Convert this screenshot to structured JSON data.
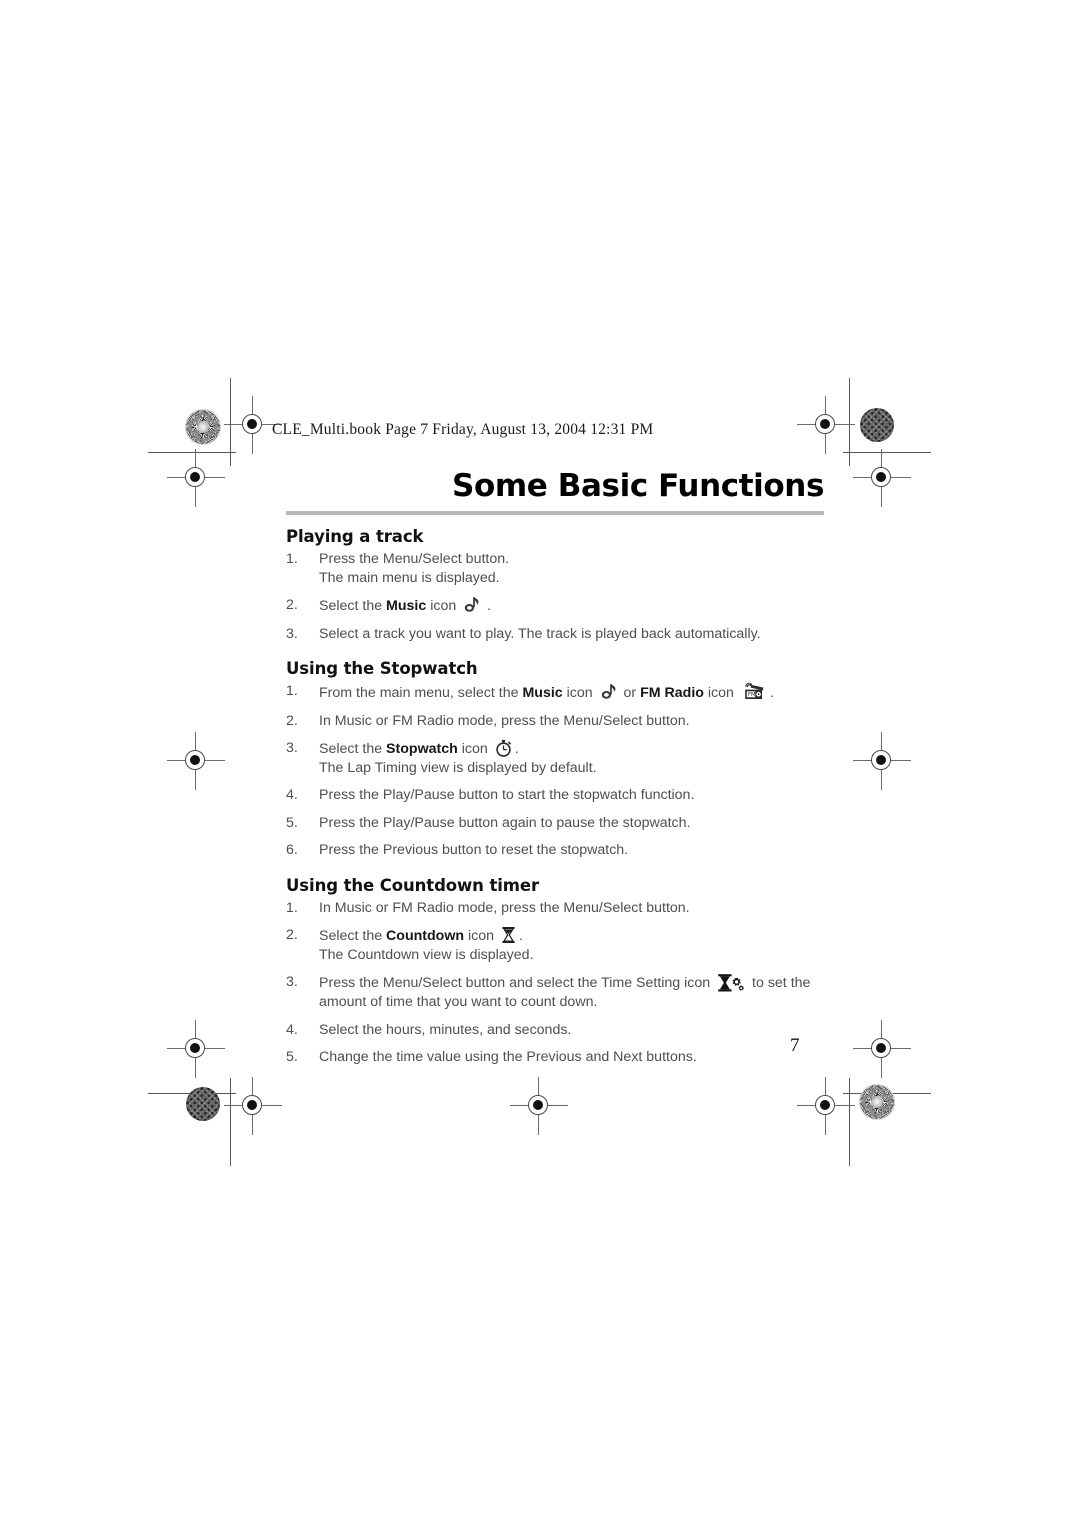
{
  "header": {
    "slug": "CLE_Multi.book  Page 7  Friday, August 13, 2004  12:31 PM"
  },
  "title": "Some Basic Functions",
  "page_number": "7",
  "colors": {
    "title_rule": "#b8b8b8",
    "body_text": "#4f4f4f",
    "heading_text": "#111111"
  },
  "sections": [
    {
      "heading": "Playing a track",
      "steps": [
        {
          "num": "1.",
          "pre": "Press the Menu/Select button.",
          "sub": "The main menu is displayed."
        },
        {
          "num": "2.",
          "pre": "Select the ",
          "term": "Music",
          "mid": " icon ",
          "icon": "music-note-icon",
          "post": " ."
        },
        {
          "num": "3.",
          "pre": "Select a track you want to play. The track is played back automatically."
        }
      ]
    },
    {
      "heading": "Using the Stopwatch",
      "steps": [
        {
          "num": "1.",
          "pre": "From the main menu, select the ",
          "term": "Music",
          "mid": " icon ",
          "icon": "music-note-icon",
          "mid2": " or ",
          "term2": "FM Radio",
          "mid3": " icon ",
          "icon2": "fm-radio-icon",
          "post": "."
        },
        {
          "num": "2.",
          "pre": "In Music or FM Radio mode, press the Menu/Select button."
        },
        {
          "num": "3.",
          "pre": "Select the ",
          "term": "Stopwatch",
          "mid": " icon ",
          "icon": "stopwatch-icon",
          "post": ".",
          "sub": "The Lap Timing view is displayed by default."
        },
        {
          "num": "4.",
          "pre": "Press the Play/Pause button to start the stopwatch function."
        },
        {
          "num": "5.",
          "pre": "Press the Play/Pause button again to pause the stopwatch."
        },
        {
          "num": "6.",
          "pre": "Press the Previous button to reset the stopwatch."
        }
      ]
    },
    {
      "heading": "Using the Countdown timer",
      "steps": [
        {
          "num": "1.",
          "pre": "In Music or FM Radio mode, press the Menu/Select button."
        },
        {
          "num": "2.",
          "pre": "Select the ",
          "term": "Countdown",
          "mid": " icon ",
          "icon": "hourglass-icon",
          "post": ".",
          "sub": "The Countdown view is displayed."
        },
        {
          "num": "3.",
          "pre": "Press the Menu/Select button and select the Time Setting icon ",
          "icon": "hourglass-gear-icon",
          "post": " to set the amount of time that you want to count down."
        },
        {
          "num": "4.",
          "pre": "Select the hours, minutes, and seconds."
        },
        {
          "num": "5.",
          "pre": "Change the time value using the Previous and Next buttons."
        }
      ]
    }
  ]
}
